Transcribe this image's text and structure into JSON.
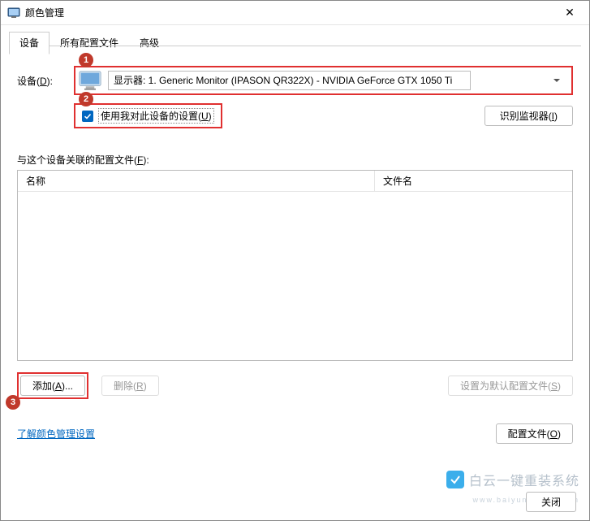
{
  "window": {
    "title": "颜色管理"
  },
  "tabs": {
    "device": "设备",
    "profiles": "所有配置文件",
    "advanced": "高级"
  },
  "device": {
    "label_pre": "设备(",
    "label_u": "D",
    "label_post": "):",
    "selected": "显示器: 1. Generic Monitor (IPASON QR322X) - NVIDIA GeForce GTX 1050 Ti",
    "use_settings_pre": "使用我对此设备的设置(",
    "use_settings_u": "U",
    "use_settings_post": ")",
    "use_settings_checked": true,
    "identify_pre": "识别监视器(",
    "identify_u": "I",
    "identify_post": ")"
  },
  "assoc": {
    "label_pre": "与这个设备关联的配置文件(",
    "label_u": "F",
    "label_post": "):",
    "col_name": "名称",
    "col_file": "文件名"
  },
  "buttons": {
    "add_pre": "添加(",
    "add_u": "A",
    "add_post": ")...",
    "remove_pre": "删除(",
    "remove_u": "R",
    "remove_post": ")",
    "default_pre": "设置为默认配置文件(",
    "default_u": "S",
    "default_post": ")",
    "profiles_pre": "配置文件(",
    "profiles_u": "O",
    "profiles_post": ")",
    "close": "关闭"
  },
  "link": "了解颜色管理设置",
  "watermark": {
    "text": "白云一键重装系统",
    "sub": "www.baiyunxitong.com"
  },
  "badges": {
    "b1": "1",
    "b2": "2",
    "b3": "3"
  }
}
